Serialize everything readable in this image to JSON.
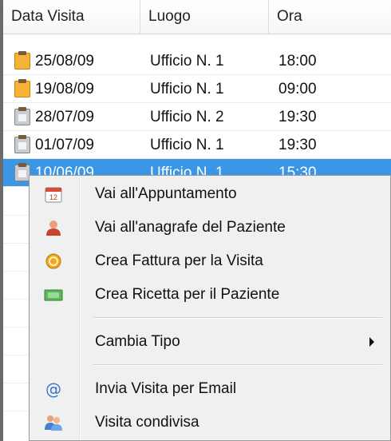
{
  "table": {
    "columns": [
      "Data Visita",
      "Luogo",
      "Ora"
    ],
    "rows": [
      {
        "date": "25/08/09",
        "place": "Ufficio N. 1",
        "time": "18:00",
        "icon": "orange-clipboard-icon"
      },
      {
        "date": "19/08/09",
        "place": "Ufficio N. 1",
        "time": "09:00",
        "icon": "orange-clipboard-icon"
      },
      {
        "date": "28/07/09",
        "place": "Ufficio N. 2",
        "time": "19:30",
        "icon": "grey-clipboard-icon"
      },
      {
        "date": "01/07/09",
        "place": "Ufficio N. 1",
        "time": "19:30",
        "icon": "grey-clipboard-icon"
      },
      {
        "date": "10/06/09",
        "place": "Ufficio N. 1",
        "time": "15:30",
        "icon": "grey-clipboard-icon",
        "selected": true
      }
    ]
  },
  "context_menu": {
    "items": [
      {
        "label": "Vai all'Appuntamento",
        "icon": "calendar-icon"
      },
      {
        "label": "Vai all'anagrafe del Paziente",
        "icon": "patient-icon"
      },
      {
        "label": "Crea Fattura per la Visita",
        "icon": "coin-icon"
      },
      {
        "label": "Crea Ricetta per il Paziente",
        "icon": "prescription-icon"
      },
      {
        "label": "Cambia Tipo",
        "icon": "",
        "submenu": true
      },
      {
        "label": "Invia Visita per Email",
        "icon": "email-at-icon"
      },
      {
        "label": "Visita condivisa",
        "icon": "shared-users-icon"
      }
    ]
  },
  "colors": {
    "selection": "#3b96e6",
    "menu_background": "#f0f0f0",
    "icon_orange": "#f6b33a"
  }
}
